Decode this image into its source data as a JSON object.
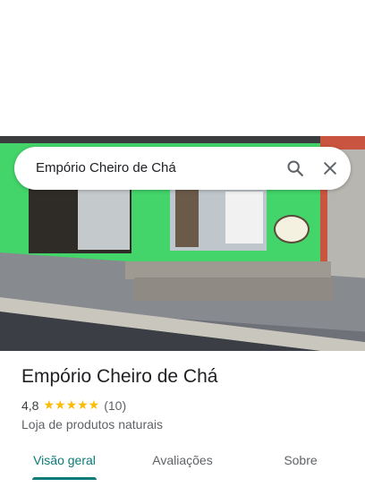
{
  "search": {
    "query": "Empório Cheiro de Chá",
    "search_icon": "search-icon",
    "close_icon": "close-icon"
  },
  "place": {
    "name": "Empório Cheiro de Chá",
    "rating": "4,8",
    "stars": "★★★★★",
    "review_count": "(10)",
    "category": "Loja de produtos naturais"
  },
  "tabs": [
    {
      "label": "Visão geral",
      "active": true
    },
    {
      "label": "Avaliações",
      "active": false
    },
    {
      "label": "Sobre",
      "active": false
    }
  ],
  "colors": {
    "accent": "#0b7a78",
    "star": "#fbbc04",
    "storefront_wall": "#43d46a"
  }
}
